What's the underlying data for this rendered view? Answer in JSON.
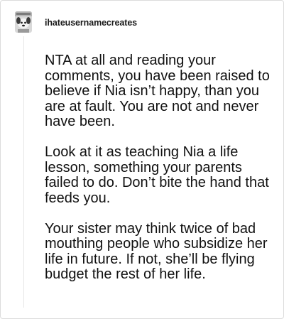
{
  "post": {
    "username": "ihateusernamecreates",
    "avatar_icon": "dog-avatar-icon",
    "paragraphs": [
      "NTA at all and reading your comments, you have been raised to believe if Nia isn’t happy, than you are at fault. You are not and never have been.",
      "Look at it as teaching Nia a life lesson, something your parents failed to do. Don’t bite the hand that feeds you.",
      "Your sister may think twice of bad mouthing people who subsidize her life in future. If not, she’ll be flying budget the rest of her life."
    ]
  }
}
